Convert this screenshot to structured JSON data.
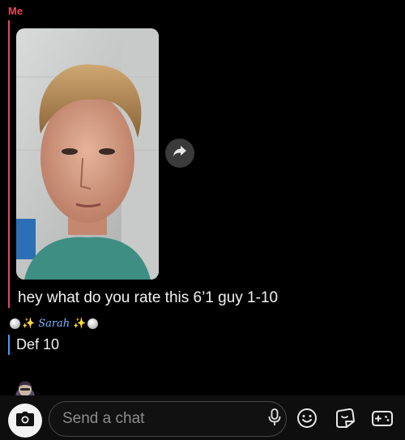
{
  "sender": {
    "me_label": "Me"
  },
  "message": {
    "text": "hey what do you rate this 6’1 guy 1-10"
  },
  "reply": {
    "sender_name": "Sarah",
    "text": "Def 10"
  },
  "composer": {
    "placeholder": "Send a chat"
  },
  "icons": {
    "share": "share-arrow-icon",
    "camera": "camera-icon",
    "mic": "microphone-icon",
    "emoji": "smiley-icon",
    "stickers": "sticker-icon",
    "games": "game-controller-icon"
  },
  "colors": {
    "me_accent": "#e9465a",
    "friend_accent": "#3aa0ff",
    "background": "#000000"
  }
}
